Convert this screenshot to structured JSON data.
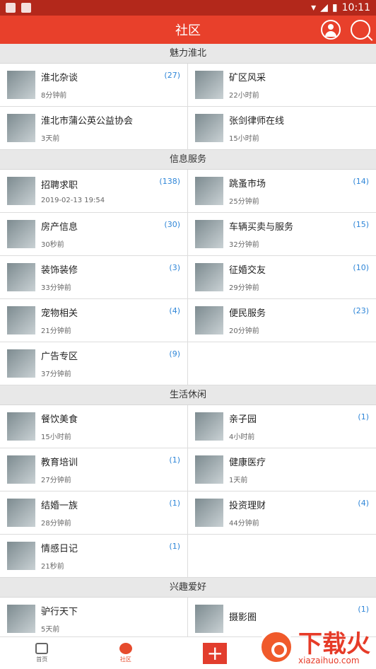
{
  "status": {
    "time": "10:11",
    "battery": "battery"
  },
  "appbar": {
    "title": "社区"
  },
  "sections": [
    {
      "title": "魅力淮北",
      "items": [
        {
          "title": "淮北杂谈",
          "time": "8分钟前",
          "count": "(27)"
        },
        {
          "title": "矿区风采",
          "time": "22小时前",
          "count": ""
        },
        {
          "title": "淮北市蒲公英公益协会",
          "time": "3天前",
          "count": ""
        },
        {
          "title": "张剑律师在线",
          "time": "15小时前",
          "count": ""
        }
      ]
    },
    {
      "title": "信息服务",
      "items": [
        {
          "title": "招聘求职",
          "time": "2019-02-13 19:54",
          "count": "(138)"
        },
        {
          "title": "跳蚤市场",
          "time": "25分钟前",
          "count": "(14)"
        },
        {
          "title": "房产信息",
          "time": "30秒前",
          "count": "(30)"
        },
        {
          "title": "车辆买卖与服务",
          "time": "32分钟前",
          "count": "(15)"
        },
        {
          "title": "装饰装修",
          "time": "33分钟前",
          "count": "(3)"
        },
        {
          "title": "征婚交友",
          "time": "29分钟前",
          "count": "(10)"
        },
        {
          "title": "宠物相关",
          "time": "21分钟前",
          "count": "(4)"
        },
        {
          "title": "便民服务",
          "time": "20分钟前",
          "count": "(23)"
        },
        {
          "title": "广告专区",
          "time": "37分钟前",
          "count": "(9)"
        },
        {
          "title": "",
          "time": "",
          "count": ""
        }
      ]
    },
    {
      "title": "生活休闲",
      "items": [
        {
          "title": "餐饮美食",
          "time": "15小时前",
          "count": ""
        },
        {
          "title": "亲子园",
          "time": "4小时前",
          "count": "(1)"
        },
        {
          "title": "教育培训",
          "time": "27分钟前",
          "count": "(1)"
        },
        {
          "title": "健康医疗",
          "time": "1天前",
          "count": ""
        },
        {
          "title": "结婚一族",
          "time": "28分钟前",
          "count": "(1)"
        },
        {
          "title": "投资理财",
          "time": "44分钟前",
          "count": "(4)"
        },
        {
          "title": "情感日记",
          "time": "21秒前",
          "count": "(1)"
        },
        {
          "title": "",
          "time": "",
          "count": ""
        }
      ]
    },
    {
      "title": "兴趣爱好",
      "items": [
        {
          "title": "驴行天下",
          "time": "5天前",
          "count": ""
        },
        {
          "title": "摄影圈",
          "time": "",
          "count": "(1)"
        }
      ]
    }
  ],
  "tabs": [
    {
      "label": "首页",
      "icon": "home-icon"
    },
    {
      "label": "社区",
      "icon": "community-icon"
    },
    {
      "label": "+",
      "icon": "plus-icon"
    }
  ],
  "watermark": {
    "main": "下载火",
    "sub": "xiazaihuo.com"
  }
}
